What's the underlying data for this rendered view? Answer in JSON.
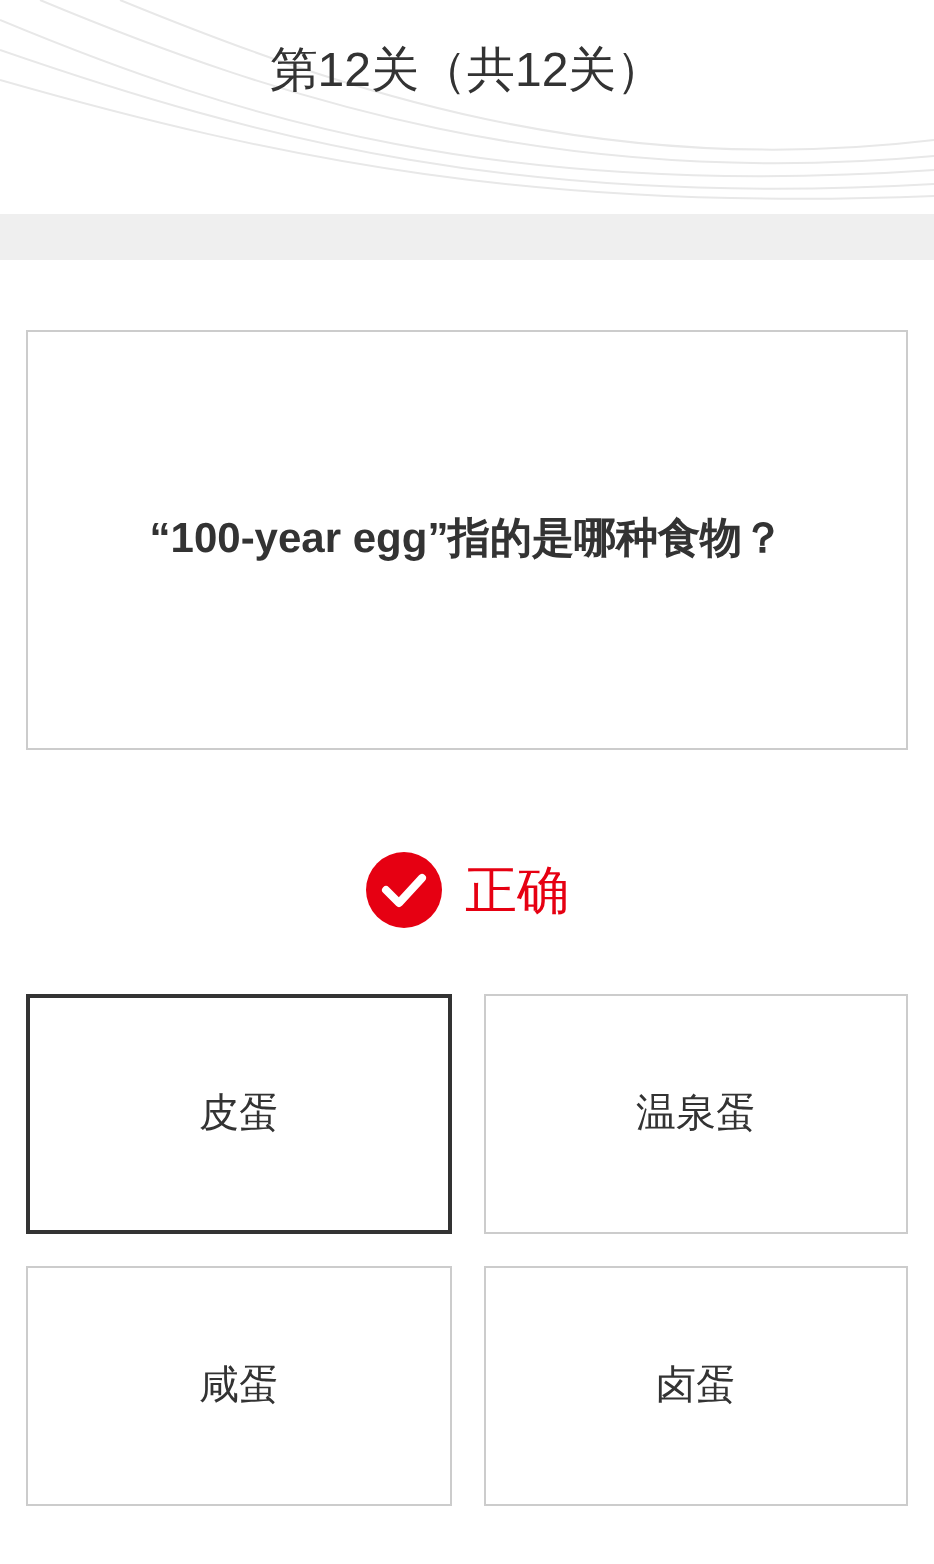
{
  "header": {
    "title": "第12关（共12关）"
  },
  "question": {
    "text": "“100-year egg”指的是哪种食物？"
  },
  "result": {
    "kind": "correct",
    "label": "正确"
  },
  "options": [
    {
      "label": "皮蛋",
      "selected": true
    },
    {
      "label": "温泉蛋",
      "selected": false
    },
    {
      "label": "咸蛋",
      "selected": false
    },
    {
      "label": "卤蛋",
      "selected": false
    }
  ]
}
